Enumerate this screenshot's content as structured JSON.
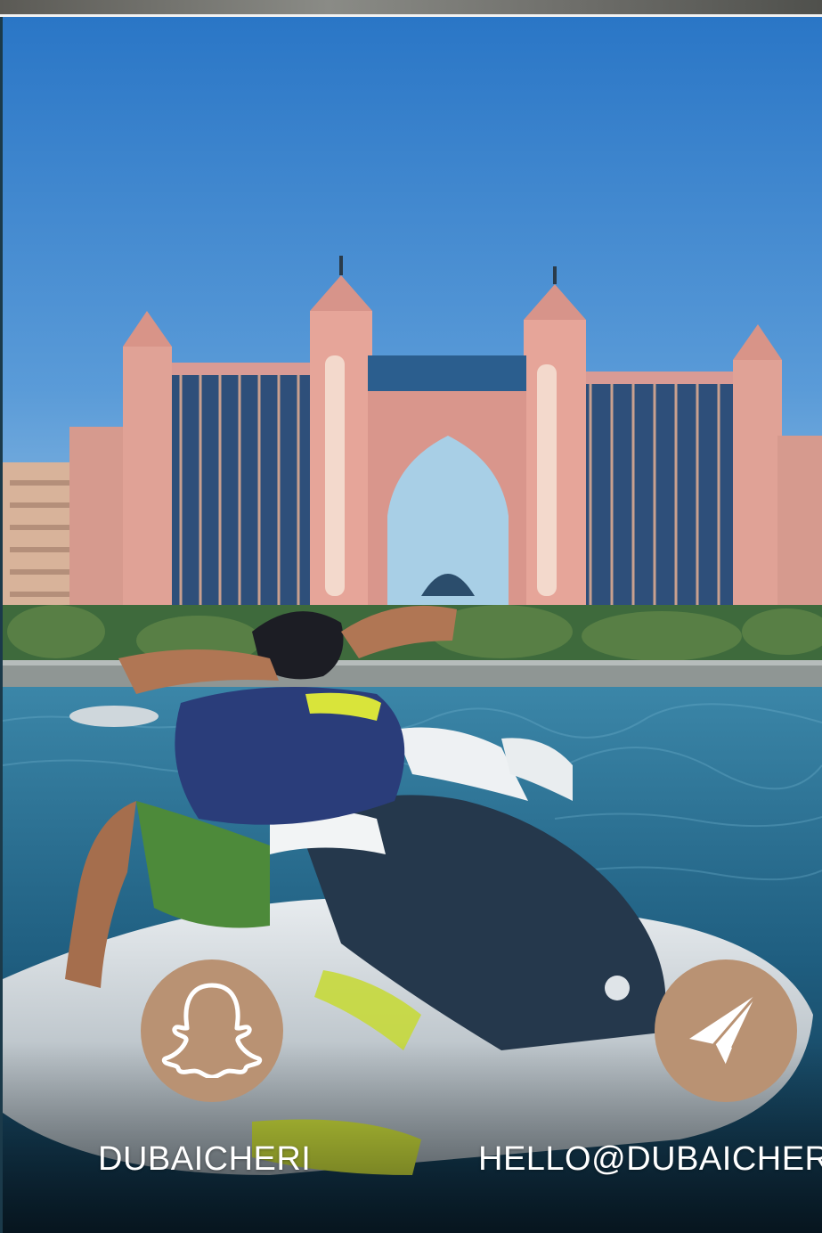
{
  "contacts": {
    "snapchat": {
      "icon": "snapchat-icon",
      "label": "DUBAICHERI"
    },
    "email": {
      "icon": "paper-plane-icon",
      "label": "HELLO@DUBAICHERI"
    }
  },
  "colors": {
    "circle": "#b99273",
    "label": "#ffffff"
  }
}
